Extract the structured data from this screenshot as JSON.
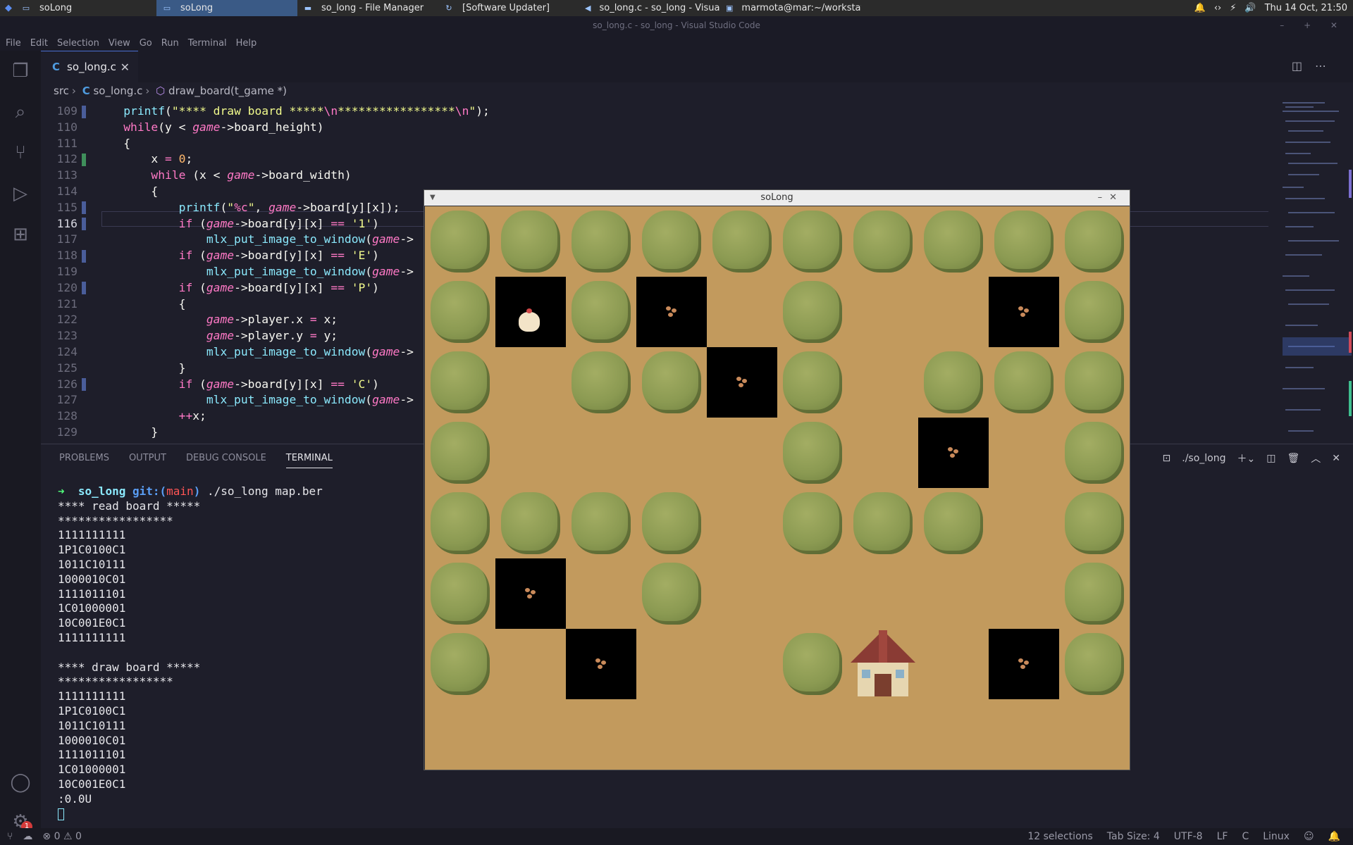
{
  "taskbar": {
    "tasks": [
      {
        "label": "soLong",
        "icon": "window-icon"
      },
      {
        "label": "soLong",
        "icon": "window-icon"
      },
      {
        "label": "so_long - File Manager",
        "icon": "folder-icon"
      },
      {
        "label": "[Software Updater]",
        "icon": "refresh-icon"
      },
      {
        "label": "so_long.c - so_long - Visual S...",
        "icon": "vscode-icon"
      },
      {
        "label": "marmota@mar:~/workstati...",
        "icon": "terminal-icon"
      }
    ],
    "clock": "Thu 14 Oct, 21:50"
  },
  "window": {
    "title": "so_long.c - so_long - Visual Studio Code"
  },
  "menu": [
    "File",
    "Edit",
    "Selection",
    "View",
    "Go",
    "Run",
    "Terminal",
    "Help"
  ],
  "tab": {
    "label": "so_long.c",
    "lang": "C"
  },
  "breadcrumb": {
    "folder": "src",
    "file": "so_long.c",
    "symbol": "draw_board(t_game *)"
  },
  "code_lines": [
    {
      "n": "109"
    },
    {
      "n": "110"
    },
    {
      "n": "111"
    },
    {
      "n": "112"
    },
    {
      "n": "113"
    },
    {
      "n": "114"
    },
    {
      "n": "115"
    },
    {
      "n": "116"
    },
    {
      "n": "117"
    },
    {
      "n": "118"
    },
    {
      "n": "119"
    },
    {
      "n": "120"
    },
    {
      "n": "121"
    },
    {
      "n": "122"
    },
    {
      "n": "123"
    },
    {
      "n": "124"
    },
    {
      "n": "125"
    },
    {
      "n": "126"
    },
    {
      "n": "127"
    },
    {
      "n": "128"
    },
    {
      "n": "129"
    }
  ],
  "panel": {
    "tabs": [
      "PROBLEMS",
      "OUTPUT",
      "DEBUG CONSOLE",
      "TERMINAL"
    ],
    "active_tab": "TERMINAL",
    "terminal_name": "./so_long"
  },
  "terminal": {
    "prompt_dir": "so_long",
    "prompt_git": "git:(",
    "prompt_branch": "main",
    "prompt_close": ")",
    "command": "./so_long map.ber",
    "lines": [
      "**** read board *****",
      "*****************",
      "1111111111",
      "1P1C0100C1",
      "1011C10111",
      "1000010C01",
      "1111011101",
      "1C01000001",
      "10C001E0C1",
      "1111111111",
      "",
      "**** draw board *****",
      "*****************",
      "1111111111",
      "1P1C0100C1",
      "1011C10111",
      "1000010C01",
      "1111011101",
      "1C01000001",
      "10C001E0C1",
      ":0.0U"
    ]
  },
  "statusbar": {
    "problems_errors": "0",
    "problems_warnings": "0",
    "selections": "12 selections",
    "tab_size": "Tab Size: 4",
    "encoding": "UTF-8",
    "eol": "LF",
    "language": "C",
    "os": "Linux"
  },
  "game": {
    "title": "soLong",
    "board": [
      "1111111111",
      "1P1C0100C1",
      "1011C10111",
      "1000010C01",
      "1111011101",
      "1C01000001",
      "10C001E0C1",
      "0000000000"
    ]
  },
  "colors": {
    "editor_bg": "#1e1e2a",
    "sand": "#c29a5d",
    "bush": "#8b9a52",
    "accent": "#4a6fd1"
  }
}
